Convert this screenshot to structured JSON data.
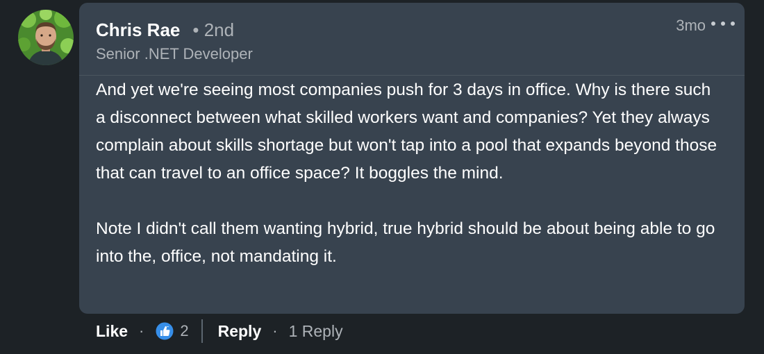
{
  "comment": {
    "author": {
      "name": "Chris Rae",
      "degree": "• 2nd",
      "headline": "Senior .NET Developer"
    },
    "time_ago": "3mo",
    "paragraphs": [
      "And yet we're seeing most companies push for 3 days in office. Why is there such a disconnect between what skilled workers want and companies? Yet they always complain about skills shortage but won't tap into a pool that expands beyond those that can travel to an office space? It boggles the mind.",
      "Note I didn't call them wanting hybrid, true hybrid should be about being able to go into the, office, not mandating it."
    ]
  },
  "actions": {
    "like_label": "Like",
    "separator": "·",
    "reaction_icon": "thumbs-up-icon",
    "reaction_count": "2",
    "reply_label": "Reply",
    "reply_count_label": "1 Reply"
  },
  "colors": {
    "background": "#1d2226",
    "bubble": "#38434f",
    "like_blue": "#378fe9"
  }
}
